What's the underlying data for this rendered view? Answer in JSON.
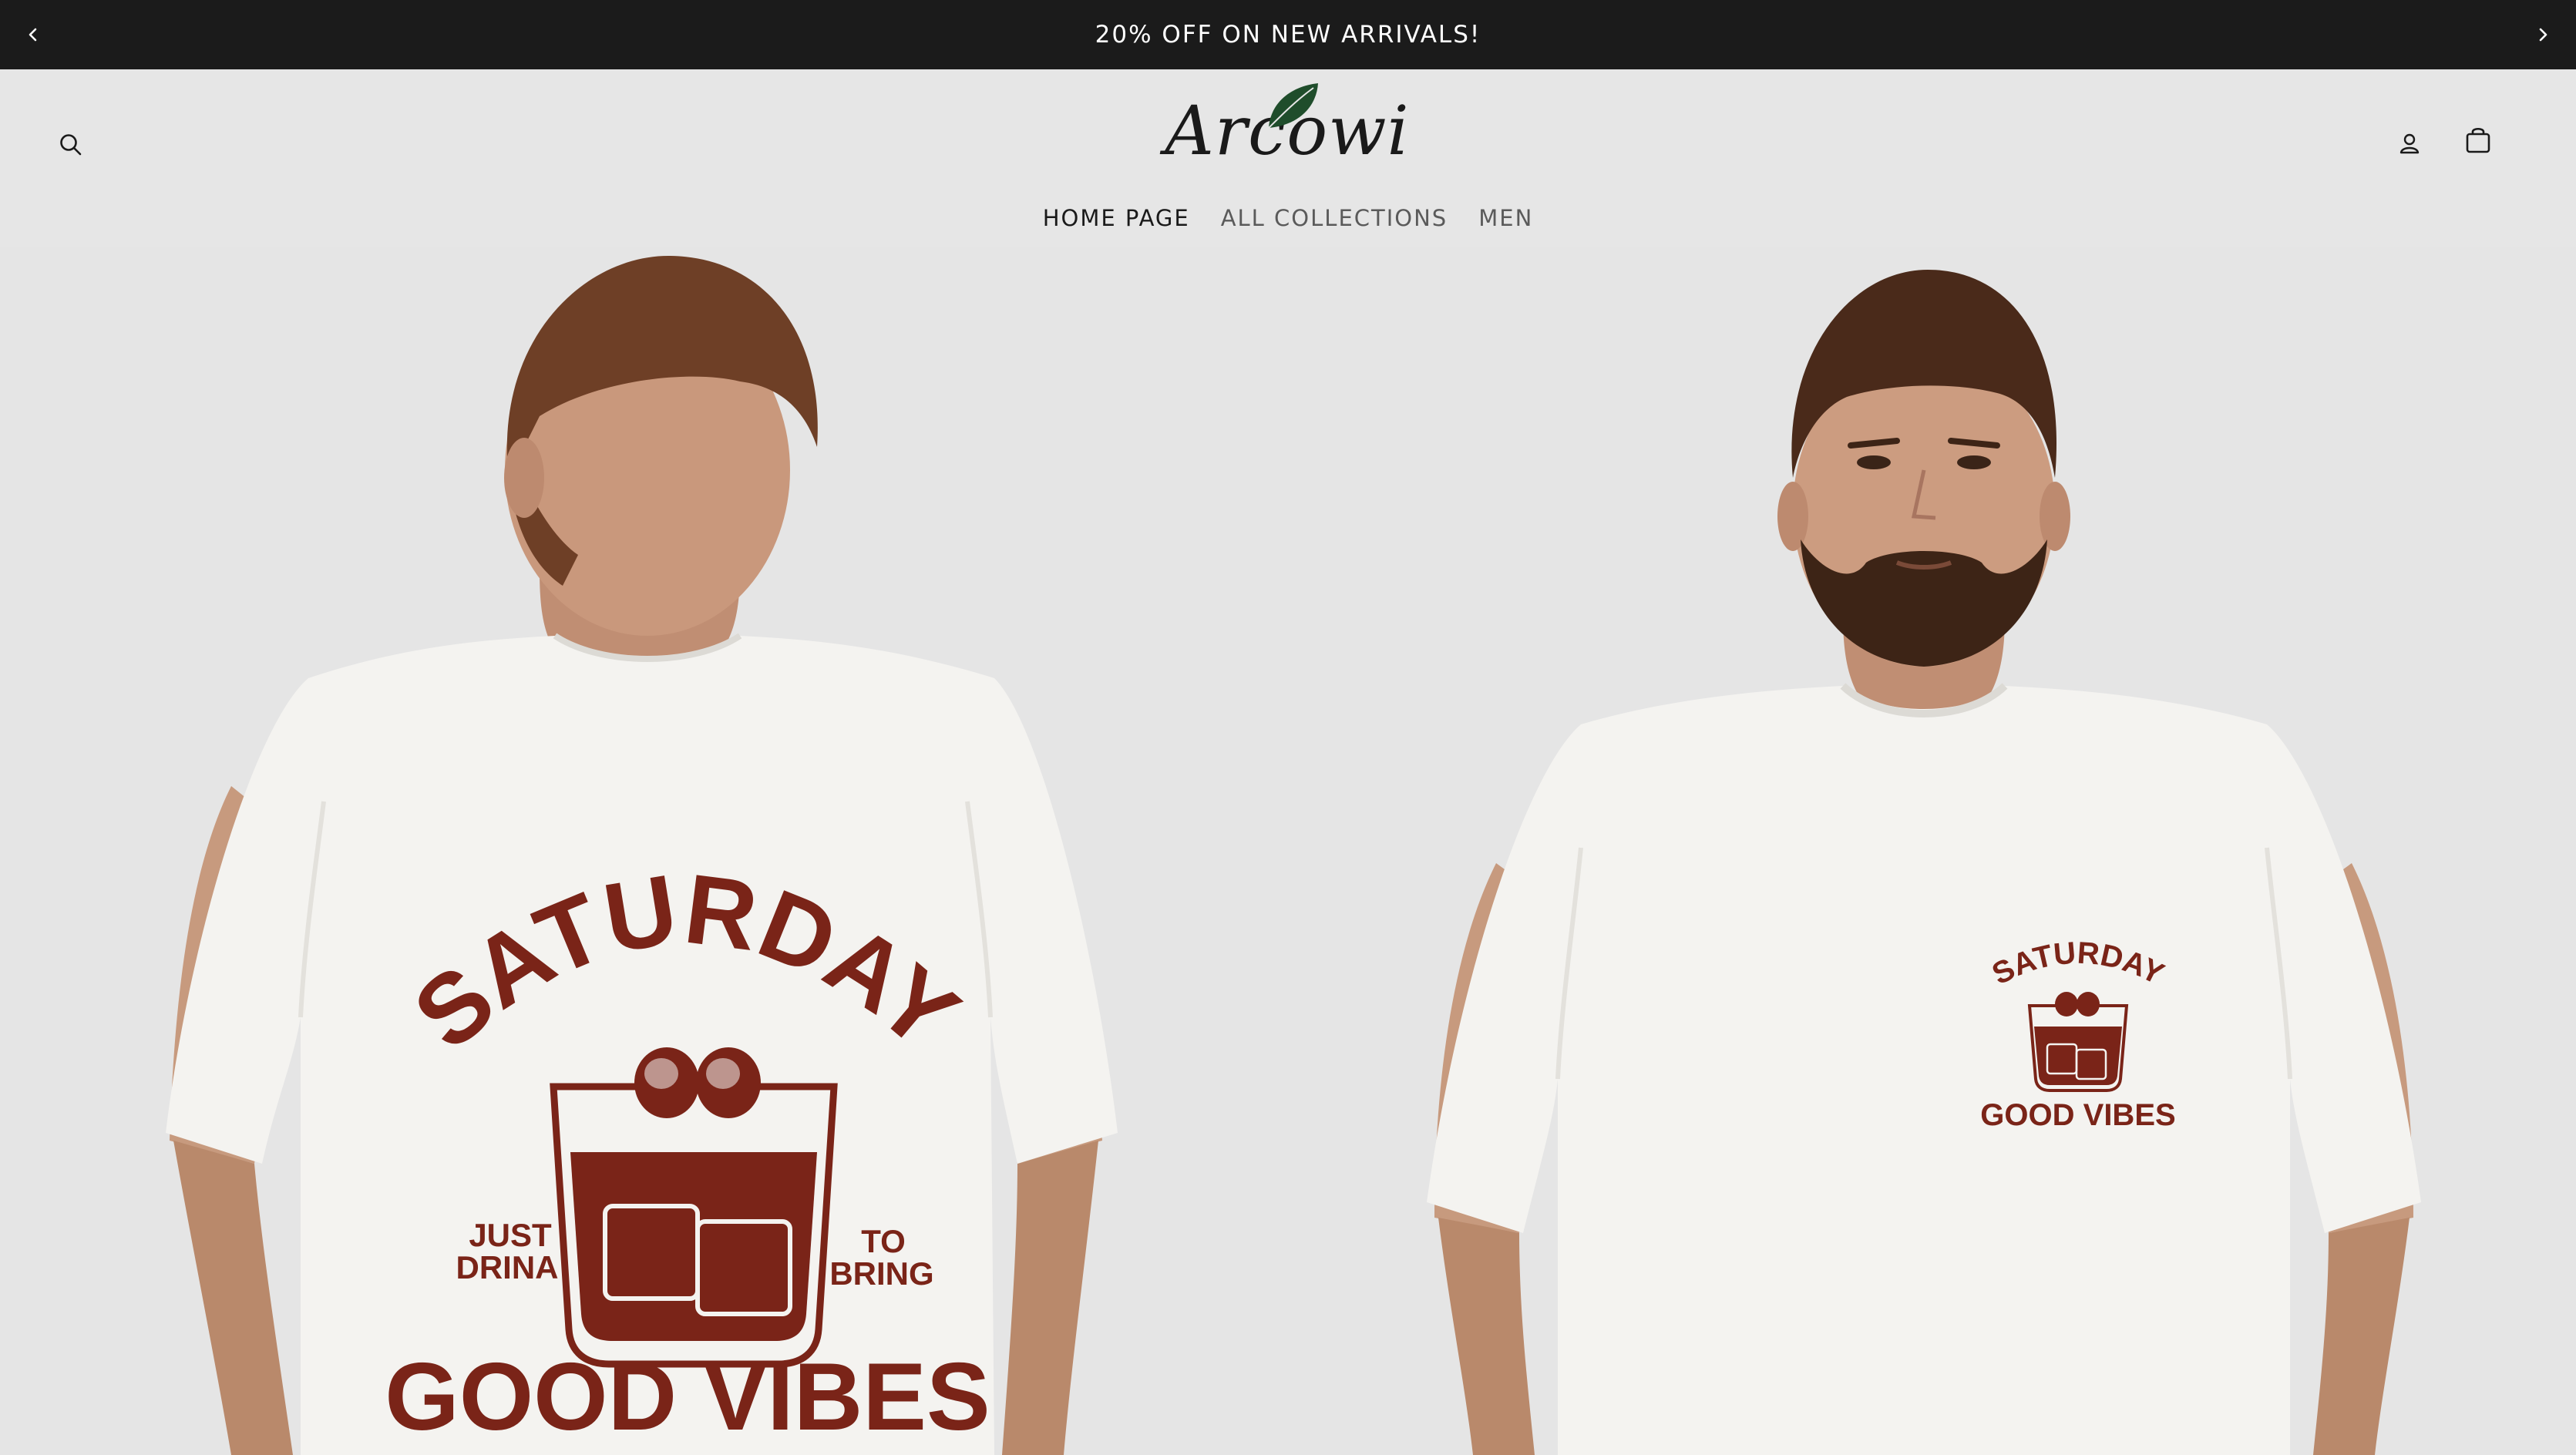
{
  "announcement": {
    "text": "20% OFF ON NEW ARRIVALS!",
    "prev_icon": "chevron-left-icon",
    "next_icon": "chevron-right-icon"
  },
  "header": {
    "logo_text": "Arcowi",
    "search_icon": "search-icon",
    "account_icon": "user-icon",
    "cart_icon": "shopping-bag-icon",
    "nav": [
      {
        "label": "HOME PAGE",
        "active": true
      },
      {
        "label": "ALL COLLECTIONS",
        "active": false
      },
      {
        "label": "MEN",
        "active": false
      }
    ]
  },
  "hero": {
    "back_print": {
      "top": "SATURDAY",
      "left_line1": "JUST",
      "left_line2": "DRINA",
      "right_line1": "TO",
      "right_line2": "BRING",
      "bottom": "GOOD VIBES"
    },
    "front_print": {
      "top": "SATURDAY",
      "bottom": "GOOD VIBES"
    }
  },
  "colors": {
    "announcement_bg": "#1b1b1b",
    "page_bg": "#e6e6e6",
    "print": "#7a2418",
    "leaf": "#1f4d2b"
  }
}
